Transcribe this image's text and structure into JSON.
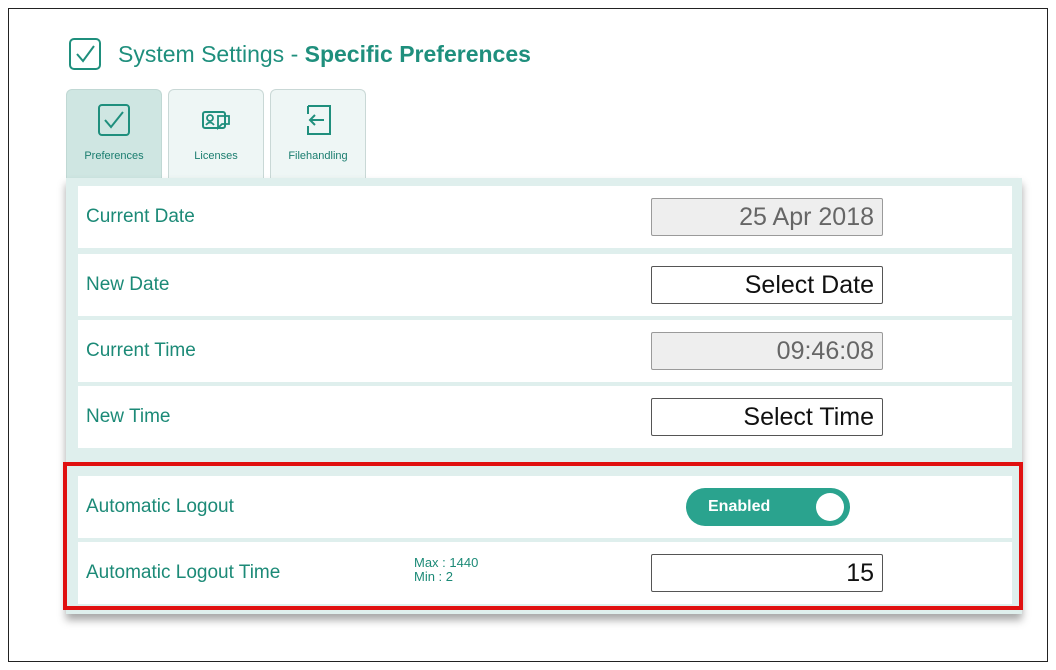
{
  "header": {
    "title_prefix": "System Settings - ",
    "title_bold": "Specific Preferences",
    "icon": "checkbox-icon"
  },
  "tabs": [
    {
      "label": "Preferences",
      "icon": "checkbox-icon",
      "active": true
    },
    {
      "label": "Licenses",
      "icon": "license-card-icon",
      "active": false
    },
    {
      "label": "Filehandling",
      "icon": "import-file-icon",
      "active": false
    }
  ],
  "rows": {
    "current_date": {
      "label": "Current Date",
      "value": "25 Apr 2018"
    },
    "new_date": {
      "label": "New Date",
      "value": "Select Date"
    },
    "current_time": {
      "label": "Current Time",
      "value": "09:46:08"
    },
    "new_time": {
      "label": "New Time",
      "value": "Select Time"
    },
    "auto_logout": {
      "label": "Automatic Logout",
      "toggle_text": "Enabled"
    },
    "auto_logout_time": {
      "label": "Automatic Logout Time",
      "max_text": "Max  : 1440",
      "min_text": "Min   : 2",
      "value": "15"
    }
  },
  "colors": {
    "accent": "#1f8f7d",
    "toggle_on": "#2aa38e",
    "panel_bg": "#dfefed",
    "highlight": "#e01010"
  }
}
